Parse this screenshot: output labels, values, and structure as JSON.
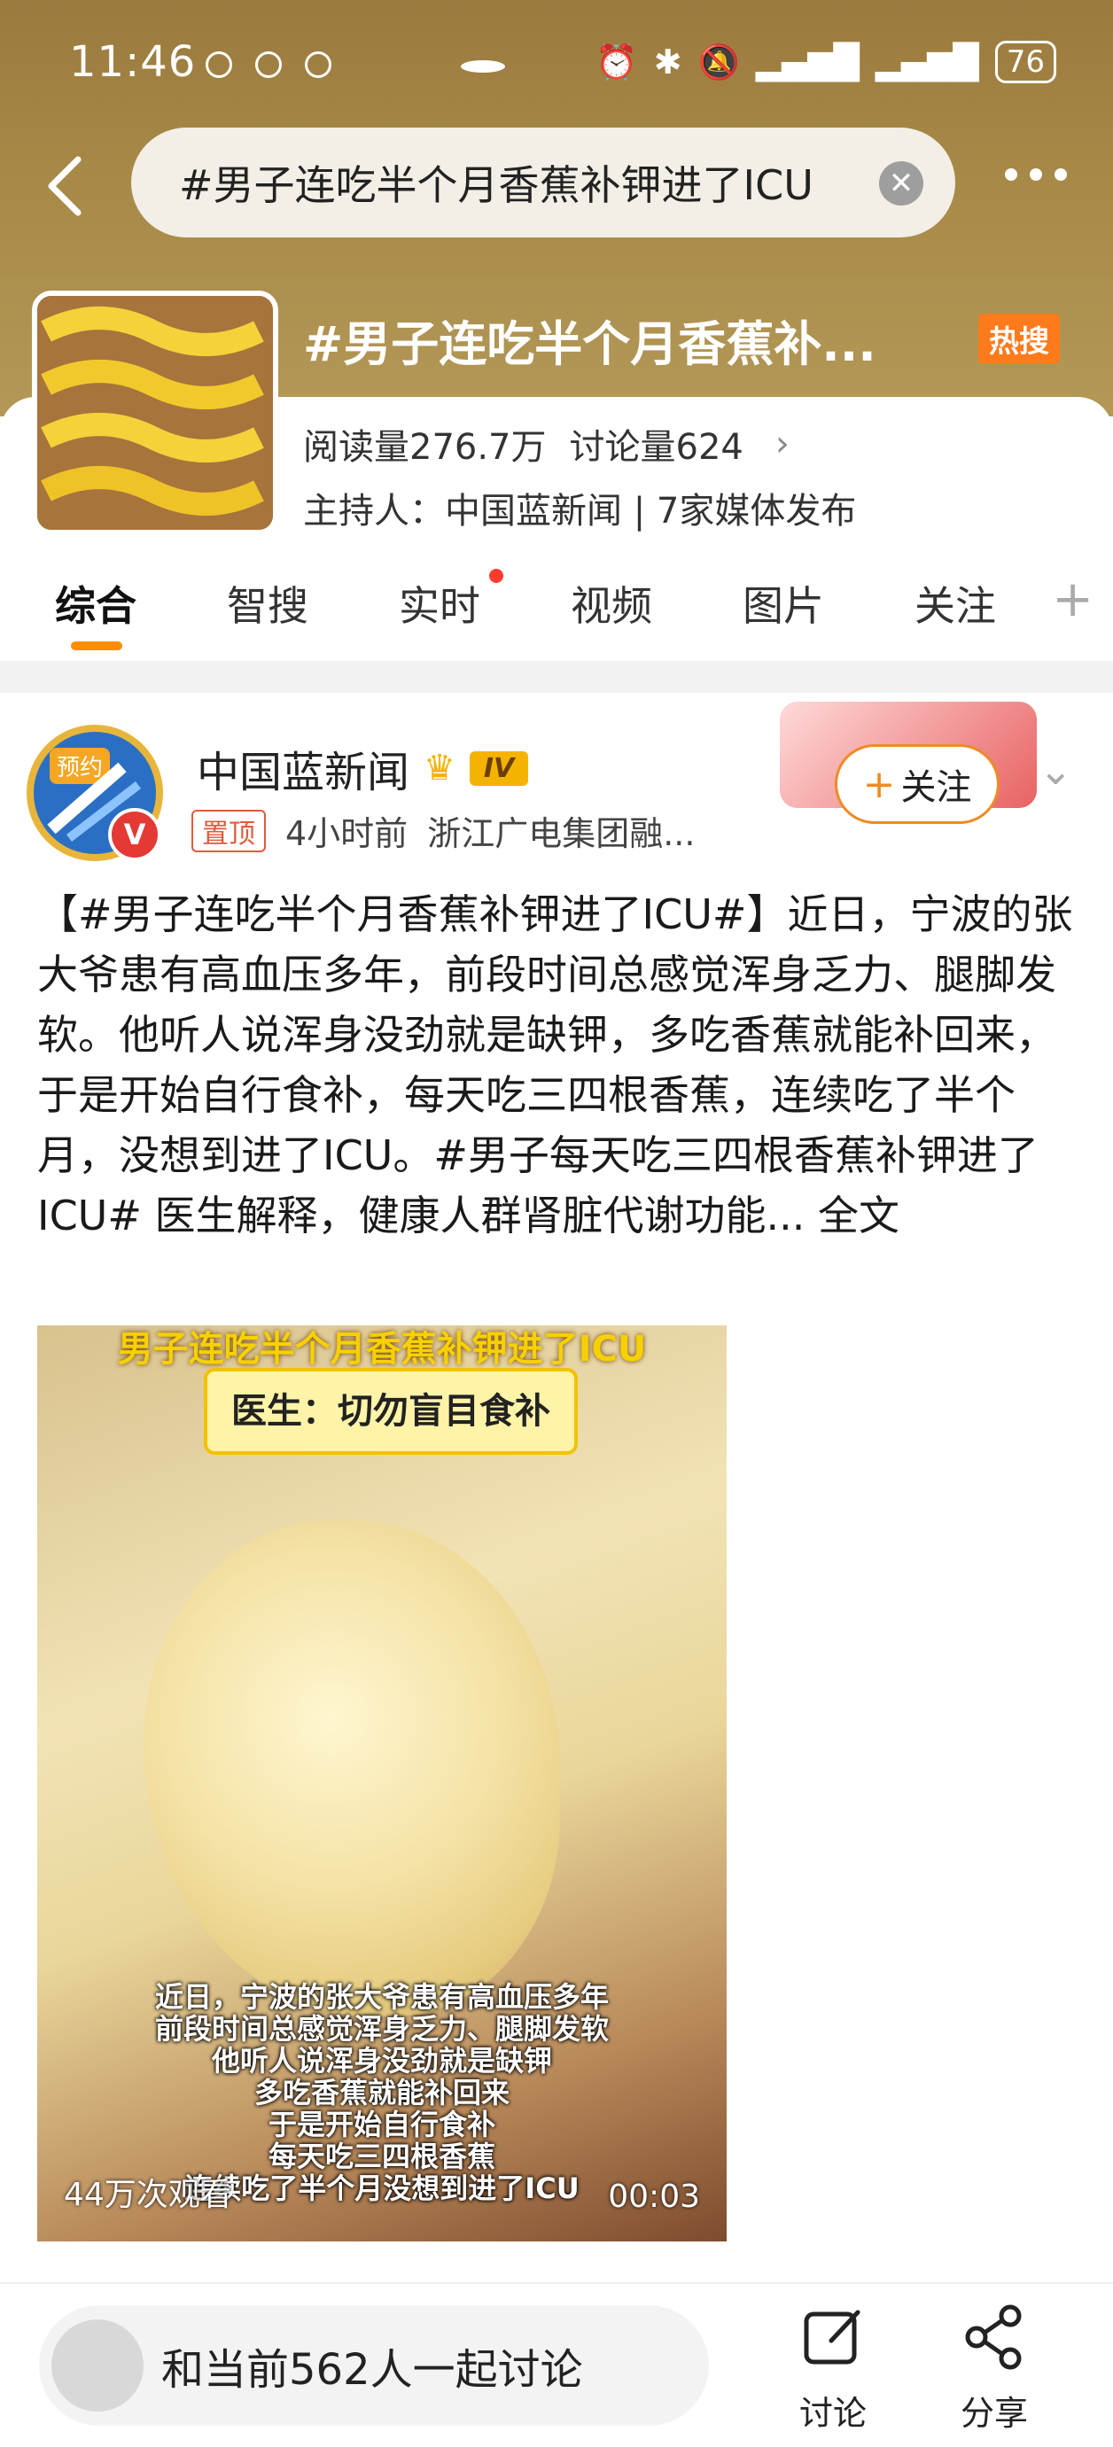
{
  "status_bar": {
    "time": "11:46",
    "battery": "76"
  },
  "search": {
    "query": "#男子连吃半个月香蕉补钾进了ICU"
  },
  "topic": {
    "title": "#男子连吃半个月香蕉补...",
    "hot_label": "热搜",
    "reads": "阅读量276.7万",
    "discussions": "讨论量624",
    "host": "主持人：中国蓝新闻 | 7家媒体发布"
  },
  "tabs": [
    "综合",
    "智搜",
    "实时",
    "视频",
    "图片",
    "关注"
  ],
  "post": {
    "avatar_tag": "预约",
    "author": "中国蓝新闻",
    "level": "IV",
    "pin_label": "置顶",
    "time": "4小时前",
    "source": "浙江广电集团融...",
    "follow_label": "关注",
    "text": "【#男子连吃半个月香蕉补钾进了ICU#】近日，宁波的张大爷患有高血压多年，前段时间总感觉浑身乏力、腿脚发软。他听人说浑身没劲就是缺钾，多吃香蕉就能补回来，于是开始自行食补，每天吃三四根香蕉，连续吃了半个月，没想到进了ICU。#男子每天吃三四根香蕉补钾进了ICU# 医生解释，健康人群肾脏代谢功能...",
    "full_text_label": "全文",
    "video": {
      "top_caption": "男子连吃半个月香蕉补钾进了ICU",
      "badge": "医生：切勿盲目食补",
      "caption_lines": [
        "近日，宁波的张大爷患有高血压多年",
        "前段时间总感觉浑身乏力、腿脚发软",
        "他听人说浑身没劲就是缺钾",
        "多吃香蕉就能补回来",
        "于是开始自行食补",
        "每天吃三四根香蕉",
        "连续吃了半个月没想到进了ICU"
      ],
      "views": "44万次观看",
      "duration": "00:03"
    }
  },
  "bottom_bar": {
    "discuss_prompt": "和当前562人一起讨论",
    "discuss_action": "讨论",
    "share_action": "分享"
  },
  "colors": {
    "accent": "#ff8c00",
    "header_bg": "#a88a48",
    "hot": "#ff7a1a"
  }
}
